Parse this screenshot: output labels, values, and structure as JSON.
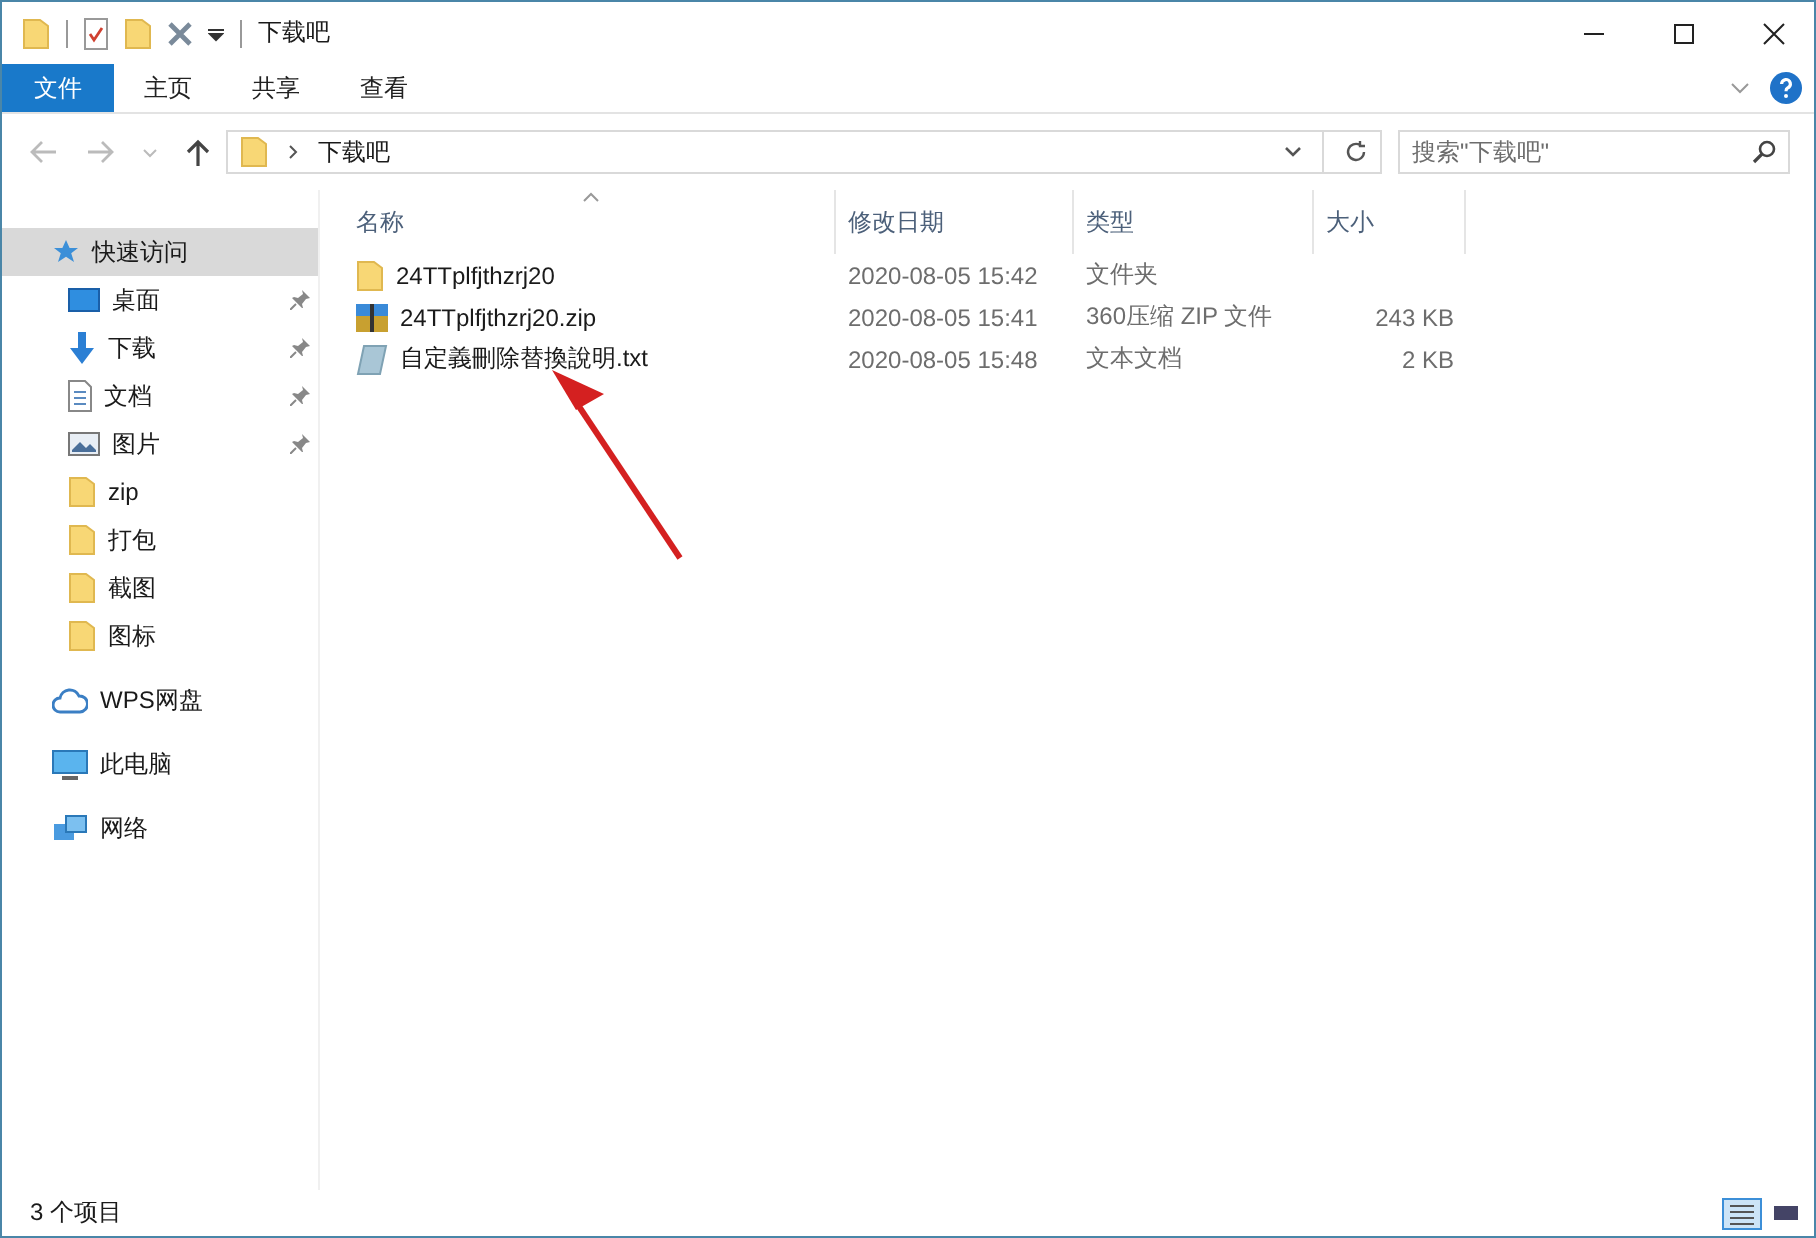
{
  "window": {
    "title": "下载吧"
  },
  "ribbon": {
    "tabs": [
      {
        "label": "文件",
        "kind": "file",
        "selected": false
      },
      {
        "label": "主页",
        "kind": "tab",
        "selected": false
      },
      {
        "label": "共享",
        "kind": "tab",
        "selected": false
      },
      {
        "label": "查看",
        "kind": "tab",
        "selected": false
      }
    ]
  },
  "address": {
    "path": "下载吧"
  },
  "search": {
    "placeholder": "搜索\"下载吧\""
  },
  "nav": [
    {
      "label": "快速访问",
      "kind": "star",
      "selected": true,
      "children": [
        {
          "label": "桌面",
          "kind": "desktop",
          "pinned": true,
          "selected": false
        },
        {
          "label": "下载",
          "kind": "download",
          "pinned": true,
          "selected": false
        },
        {
          "label": "文档",
          "kind": "document",
          "pinned": true,
          "selected": false
        },
        {
          "label": "图片",
          "kind": "picture",
          "pinned": true,
          "selected": false
        },
        {
          "label": "zip",
          "kind": "folder",
          "pinned": false,
          "selected": false
        },
        {
          "label": "打包",
          "kind": "folder",
          "pinned": false,
          "selected": false
        },
        {
          "label": "截图",
          "kind": "folder",
          "pinned": false,
          "selected": false
        },
        {
          "label": "图标",
          "kind": "folder",
          "pinned": false,
          "selected": false
        }
      ]
    },
    {
      "label": "WPS网盘",
      "kind": "cloud",
      "selected": false
    },
    {
      "label": "此电脑",
      "kind": "pc",
      "selected": false
    },
    {
      "label": "网络",
      "kind": "network",
      "selected": false
    }
  ],
  "table": {
    "columns": [
      {
        "label": "名称",
        "sorted": true
      },
      {
        "label": "修改日期",
        "sorted": false
      },
      {
        "label": "类型",
        "sorted": false
      },
      {
        "label": "大小",
        "sorted": false
      }
    ],
    "rows": [
      {
        "kind": "folder",
        "name": "24TTplfjthzrj20",
        "date": "2020-08-05 15:42",
        "type": "文件夹",
        "size": ""
      },
      {
        "kind": "zip",
        "name": "24TTplfjthzrj20.zip",
        "date": "2020-08-05 15:41",
        "type": "360压缩 ZIP 文件",
        "size": "243 KB"
      },
      {
        "kind": "text",
        "name": "自定義刪除替換說明.txt",
        "date": "2020-08-05 15:48",
        "type": "文本文档",
        "size": "2 KB"
      }
    ]
  },
  "status_bar": {
    "count": "3 个项目",
    "views": [
      {
        "kind": "details",
        "selected": true
      },
      {
        "kind": "tiles",
        "selected": false
      }
    ]
  }
}
